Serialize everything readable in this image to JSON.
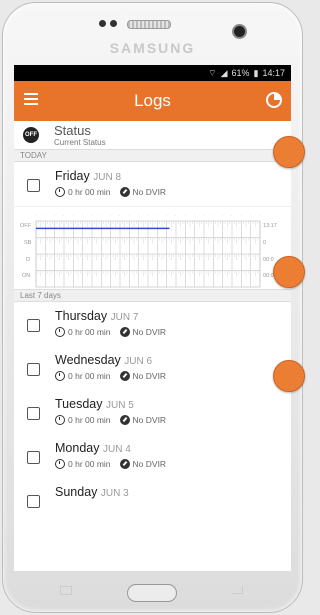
{
  "device": {
    "brand": "SAMSUNG"
  },
  "statusbar": {
    "battery": "61%",
    "time": "14:17"
  },
  "appbar": {
    "title": "Logs"
  },
  "current_status": {
    "badge": "OFF",
    "title": "Status",
    "subtitle": "Current Status"
  },
  "sections": {
    "today": "TODAY",
    "last7": "Last 7 days"
  },
  "today": {
    "day": "Friday",
    "date": "JUN 8",
    "hours": "0 hr 00 min",
    "dvir": "No DVIR"
  },
  "graph": {
    "rows": [
      "OFF",
      "SB",
      "D",
      "ON"
    ],
    "totals": [
      "13:17",
      "0",
      "00:0",
      "00:00"
    ]
  },
  "days": [
    {
      "day": "Thursday",
      "date": "JUN 7",
      "hours": "0 hr 00 min",
      "dvir": "No DVIR"
    },
    {
      "day": "Wednesday",
      "date": "JUN 6",
      "hours": "0 hr 00 min",
      "dvir": "No DVIR"
    },
    {
      "day": "Tuesday",
      "date": "JUN 5",
      "hours": "0 hr 00 min",
      "dvir": "No DVIR"
    },
    {
      "day": "Monday",
      "date": "JUN 4",
      "hours": "0 hr 00 min",
      "dvir": "No DVIR"
    },
    {
      "day": "Sunday",
      "date": "JUN 3"
    }
  ],
  "colors": {
    "accent": "#e8742c",
    "duty_line": "#2b4bd8"
  }
}
